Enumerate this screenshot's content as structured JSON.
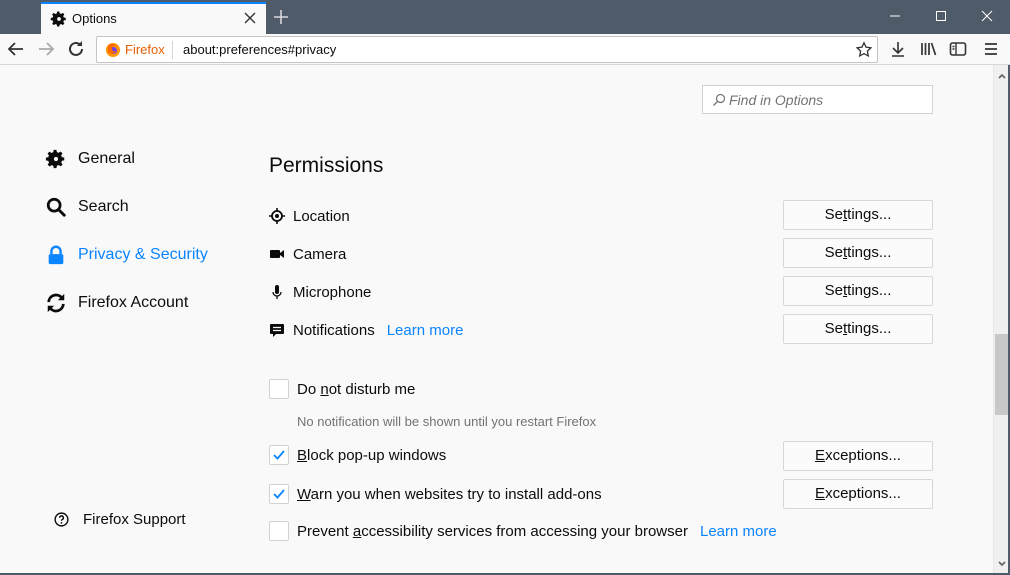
{
  "window": {
    "tab_title": "Options",
    "tab_icon": "gear-icon",
    "new_tab_icon": "plus-icon",
    "controls": [
      "minimize-icon",
      "maximize-icon",
      "close-icon"
    ]
  },
  "navbar": {
    "identity_label": "Firefox",
    "url": "about:preferences#privacy",
    "toolbar_icons": [
      "downloads-icon",
      "library-icon",
      "sidebar-icon",
      "menu-icon"
    ]
  },
  "search": {
    "placeholder": "Find in Options",
    "value": ""
  },
  "sidebar": {
    "items": [
      {
        "label": "General",
        "icon": "gear-icon",
        "active": false
      },
      {
        "label": "Search",
        "icon": "search-icon",
        "active": false
      },
      {
        "label": "Privacy & Security",
        "icon": "lock-icon",
        "active": true
      },
      {
        "label": "Firefox Account",
        "icon": "sync-icon",
        "active": false
      }
    ],
    "support_label": "Firefox Support"
  },
  "permissions": {
    "title": "Permissions",
    "rows": [
      {
        "label": "Location",
        "icon": "location-icon",
        "button": "Settings..."
      },
      {
        "label": "Camera",
        "icon": "camera-icon",
        "button": "Settings..."
      },
      {
        "label": "Microphone",
        "icon": "microphone-icon",
        "button": "Settings..."
      },
      {
        "label": "Notifications",
        "icon": "notification-icon",
        "button": "Settings...",
        "link": "Learn more"
      }
    ],
    "dnd": {
      "pre": "Do ",
      "key": "n",
      "post": "ot disturb me",
      "checked": false,
      "hint": "No notification will be shown until you restart Firefox"
    },
    "block_popups": {
      "pre": "",
      "key": "B",
      "post": "lock pop-up windows",
      "checked": true,
      "button_key": "E",
      "button_rest": "xceptions..."
    },
    "warn_addons": {
      "pre": "",
      "key": "W",
      "post": "arn you when websites try to install add-ons",
      "checked": true,
      "button_key": "E",
      "button_rest": "xceptions..."
    },
    "accessibility": {
      "pre": "Prevent ",
      "key": "a",
      "post": "ccessibility services from accessing your browser",
      "checked": false,
      "link": "Learn more"
    }
  },
  "settings_button": {
    "pre": "Se",
    "key": "t",
    "post": "tings..."
  },
  "colors": {
    "accent": "#0a84ff",
    "tabstrip": "#4f5b69",
    "content_bg": "#f9f9fa"
  }
}
